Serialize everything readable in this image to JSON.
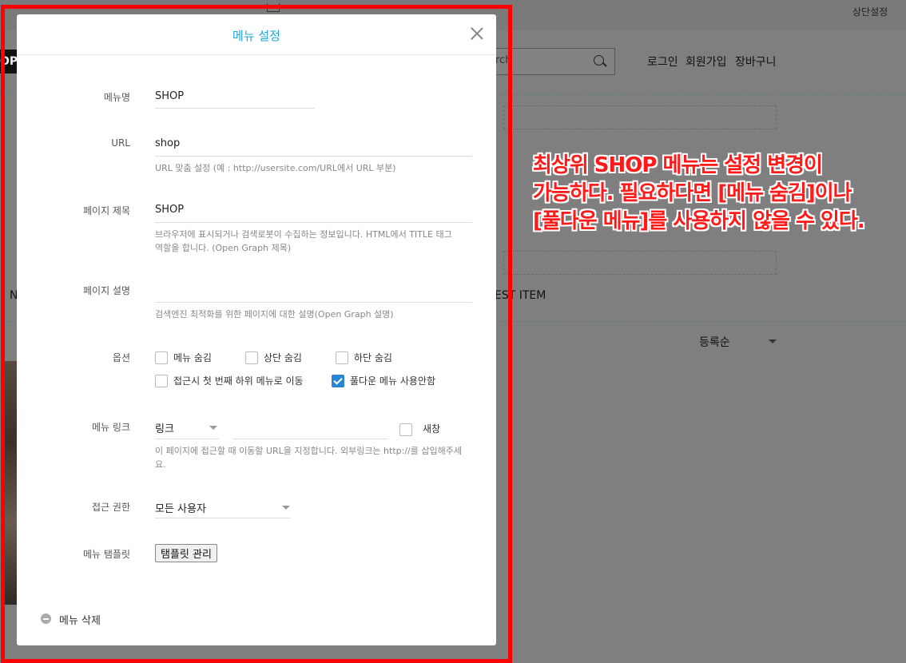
{
  "background": {
    "top_settings": "상단설정",
    "logo_text": "OP",
    "search_placeholder": "rch",
    "nav": [
      "로그인",
      "회원가입",
      "장바구니"
    ],
    "left_fragment": "N",
    "section_label": "EST ITEM",
    "sort_dropdown": "등록순"
  },
  "annotation": {
    "lines": [
      "최상위 SHOP 메뉴는 설정 변경이",
      "가능하다. 필요하다면 [메뉴 숨김]이나",
      "[풀다운 메뉴]를 사용하지 않을 수 있다."
    ],
    "color": "#ff1a1a"
  },
  "modal": {
    "title": "메뉴 설정",
    "fields": {
      "menu_name": {
        "label": "메뉴명",
        "value": "SHOP"
      },
      "url": {
        "label": "URL",
        "value": "shop",
        "help": "URL 맞춤 설정 (예 : http://usersite.com/URL에서 URL 부분)"
      },
      "page_title": {
        "label": "페이지 제목",
        "value": "SHOP",
        "help1": "브라우저에 표시되거나 검색로봇이 수집하는 정보입니다. HTML에서 TITLE 태그",
        "help2": "역할을 합니다. (Open Graph 제목)"
      },
      "page_desc": {
        "label": "페이지 설명",
        "value": "",
        "help": "검색엔진 최적화를 위한 페이지에 대한 설명(Open Graph 설명)"
      },
      "options": {
        "label": "옵션",
        "items": [
          {
            "label": "메뉴 숨김",
            "checked": false
          },
          {
            "label": "상단 숨김",
            "checked": false
          },
          {
            "label": "하단 숨김",
            "checked": false
          },
          {
            "label": "접근시 첫 번째 하위 메뉴로 이동",
            "checked": false
          },
          {
            "label": "풀다운 메뉴 사용안함",
            "checked": true
          }
        ]
      },
      "menu_link": {
        "label": "메뉴 링크",
        "type": "링크",
        "url_value": "",
        "new_window": "새창",
        "new_window_checked": false,
        "help1": "이 페이지에 접근할 때 이동할 URL을 지정합니다. 외부링크는 http://를 삽입해주세",
        "help2": "요."
      },
      "access": {
        "label": "접근 권한",
        "value": "모든 사용자"
      },
      "template": {
        "label": "메뉴 탬플릿",
        "button": "탬플릿 관리"
      }
    },
    "delete_label": "메뉴 삭제",
    "accent_color": "#1ea7d9",
    "checkbox_color": "#2a85d4"
  }
}
